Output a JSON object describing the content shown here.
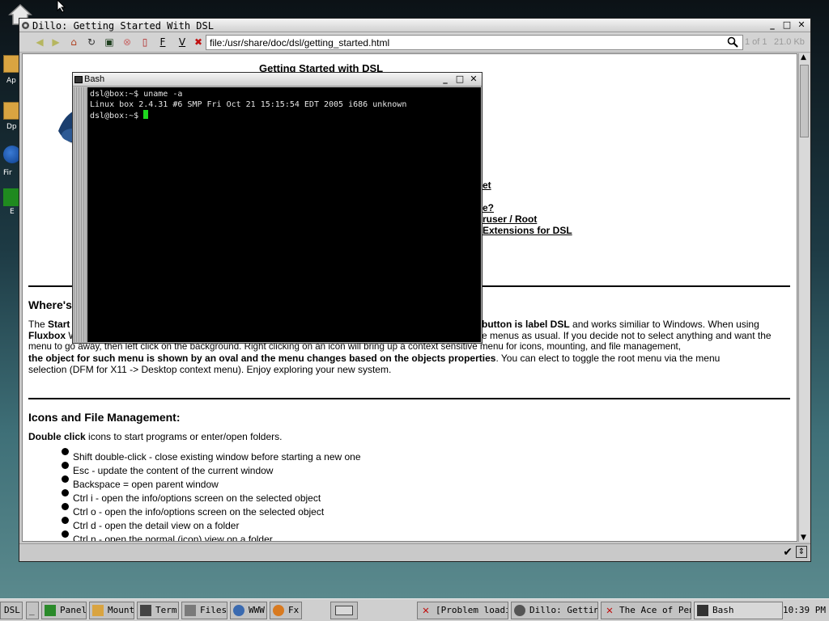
{
  "desktop": {
    "icons": [
      {
        "label": "Ap"
      },
      {
        "label": "Dp"
      },
      {
        "label": "Fir"
      },
      {
        "label": "E"
      }
    ]
  },
  "dillo": {
    "title": "Dillo: Getting Started With DSL",
    "toolbar": {
      "back": "◀",
      "forward": "▶",
      "home": "⌂",
      "reload": "↻",
      "save": "▣",
      "stop": "⊗",
      "bookmarks": "▯",
      "f_label": "F",
      "v_label": "V",
      "url": "file:/usr/share/doc/dsl/getting_started.html",
      "page_counter": "1 of 1",
      "size": "21.0 Kb"
    },
    "page": {
      "heading": "Getting Started with DSL",
      "toc_fragments": [
        "et",
        "e?",
        "ruser / Root",
        "Extensions for DSL"
      ],
      "section1": {
        "title": "Where's",
        "line1_start": "The",
        "line1_bold_start": "Start",
        "line1_bold": "button is label DSL",
        "line1_end": "and works similiar to Windows. When using",
        "line2_bold": "Fluxbox",
        "line2_text": "W",
        "line2_end": "e menus as usual. If you decide not to select anything and want the",
        "line3": "menu to go away, then left click on the background. Right clicking on an icon will bring up a context sensitive menu for icons, mounting, and file management,",
        "line4_bold": "the object for such menu is shown by an oval and the menu changes based on the objects properties",
        "line4_end": ". You can elect to toggle the root menu via the menu",
        "line5": "selection (DFM for X11 -> Desktop context menu). Enjoy exploring your new system."
      },
      "section2": {
        "title": "Icons and File Management:",
        "intro_bold": "Double click",
        "intro": "icons to start programs or enter/open folders.",
        "items": [
          "Shift double-click - close existing window before starting a new one",
          "Esc - update the content of the current window",
          "Backspace = open parent window",
          "Ctrl i - open the info/options screen on the selected object",
          "Ctrl o - open the info/options screen on the selected object",
          "Ctrl d - open the detail view on a folder",
          "Ctrl n - open the normal (icon) view on a folder"
        ]
      }
    }
  },
  "bash": {
    "title": "Bash",
    "lines": [
      "dsl@box:~$ uname -a",
      "Linux box 2.4.31 #6 SMP Fri Oct 21 15:15:54 EDT 2005 i686 unknown",
      "dsl@box:~$ "
    ]
  },
  "taskbar": {
    "start": "DSL",
    "minimize": "_",
    "launchers": [
      "Panel",
      "Mount",
      "Term",
      "Files",
      "WWW",
      "Fx"
    ],
    "tasks": [
      "[Problem loadi",
      "Dillo: Getting",
      "The Ace of Pen",
      "Bash"
    ],
    "clock": "10:39 PM"
  },
  "colors": {
    "terminal_bg": "#000000",
    "cursor": "#1ed81e",
    "titlebar": "#d8d8d8"
  }
}
